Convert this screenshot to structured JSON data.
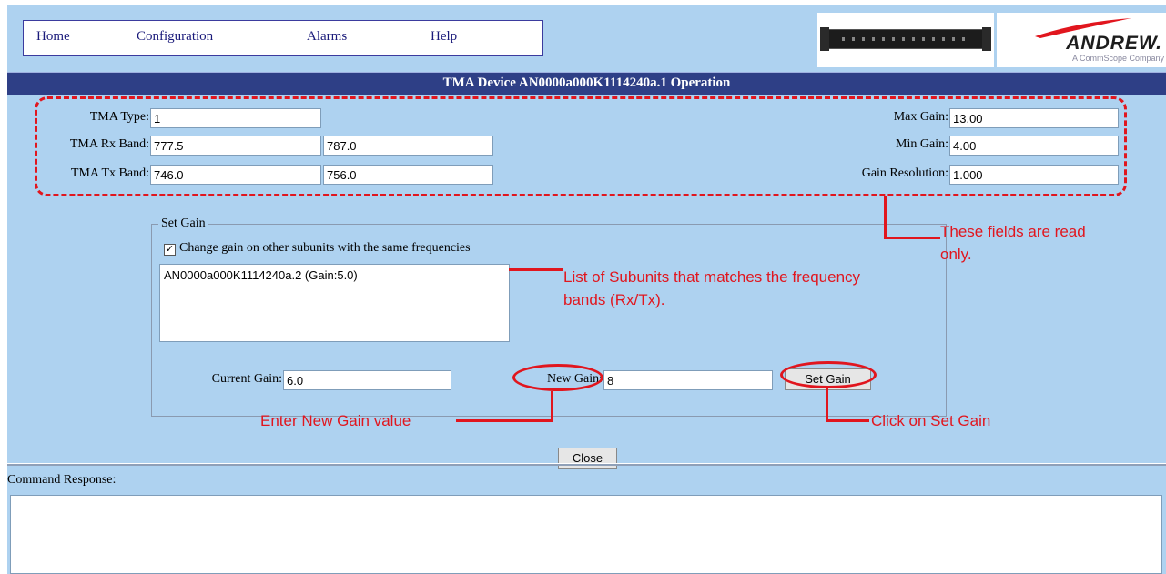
{
  "nav": {
    "home": "Home",
    "configuration": "Configuration",
    "alarms": "Alarms",
    "help": "Help"
  },
  "logo": {
    "brand": "ANDREW.",
    "tagline": "A CommScope Company"
  },
  "title": "TMA Device AN0000a000K1114240a.1 Operation",
  "fields": {
    "tma_type_label": "TMA Type:",
    "tma_type": "1",
    "rx_band_label": "TMA Rx Band:",
    "rx_band_low": "777.5",
    "rx_band_high": "787.0",
    "tx_band_label": "TMA Tx Band:",
    "tx_band_low": "746.0",
    "tx_band_high": "756.0",
    "max_gain_label": "Max Gain:",
    "max_gain": "13.00",
    "min_gain_label": "Min Gain:",
    "min_gain": "4.00",
    "gain_resolution_label": "Gain Resolution:",
    "gain_resolution": "1.000"
  },
  "set_gain": {
    "legend": "Set Gain",
    "checkbox_label": "Change gain on other subunits with the same frequencies",
    "checkbox_checked": true,
    "subunits": [
      "AN0000a000K1114240a.2 (Gain:5.0)"
    ],
    "current_gain_label": "Current Gain:",
    "current_gain": "6.0",
    "new_gain_label": "New Gain:",
    "new_gain": "8",
    "set_gain_button": "Set Gain"
  },
  "close_button": "Close",
  "command_response_label": "Command Response:",
  "annotations": {
    "read_only_line1": "These fields are read",
    "read_only_line2": "only.",
    "subunits_line1": "List of Subunits that matches the frequency",
    "subunits_line2": "bands (Rx/Tx).",
    "enter_new_gain": "Enter New Gain value",
    "click_set_gain": "Click on Set Gain"
  },
  "colors": {
    "background": "#aed2f0",
    "title_bar": "#2e3f86",
    "annotation": "#e1161e"
  }
}
